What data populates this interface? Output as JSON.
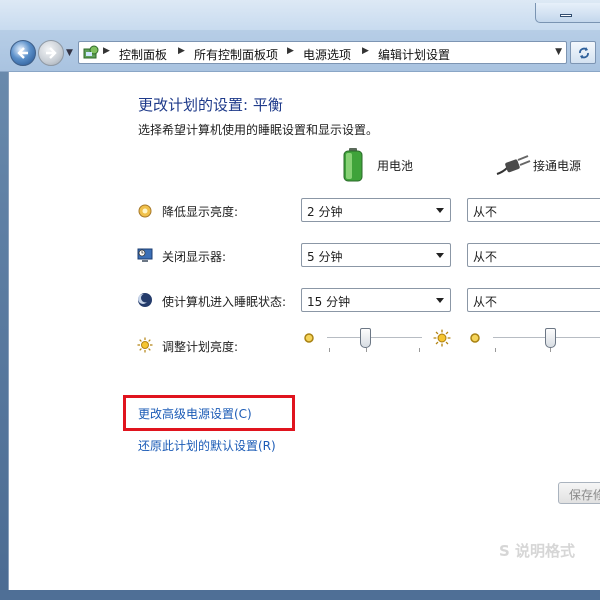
{
  "breadcrumb": [
    "控制面板",
    "所有控制面板项",
    "电源选项",
    "编辑计划设置"
  ],
  "header": {
    "title": "更改计划的设置: 平衡",
    "subtitle": "选择希望计算机使用的睡眠设置和显示设置。"
  },
  "columns": {
    "battery": "用电池",
    "plugged": "接通电源"
  },
  "settings": [
    {
      "label": "降低显示亮度:",
      "icon": "dim-display-icon",
      "battery": "2 分钟",
      "plugged": "从不"
    },
    {
      "label": "关闭显示器:",
      "icon": "monitor-off-icon",
      "battery": "5 分钟",
      "plugged": "从不"
    },
    {
      "label": "使计算机进入睡眠状态:",
      "icon": "sleep-moon-icon",
      "battery": "15 分钟",
      "plugged": "从不"
    }
  ],
  "brightness": {
    "label": "调整计划亮度:",
    "battery_level": 0.4,
    "plugged_level": 0.6
  },
  "links": {
    "advanced": "更改高级电源设置(C)",
    "restore": "还原此计划的默认设置(R)"
  },
  "buttons": {
    "save": "保存修改"
  },
  "watermark": "S 说明格式",
  "colors": {
    "title": "#1e3a8a",
    "link": "#1b5bb6",
    "highlight": "#e0141e"
  }
}
